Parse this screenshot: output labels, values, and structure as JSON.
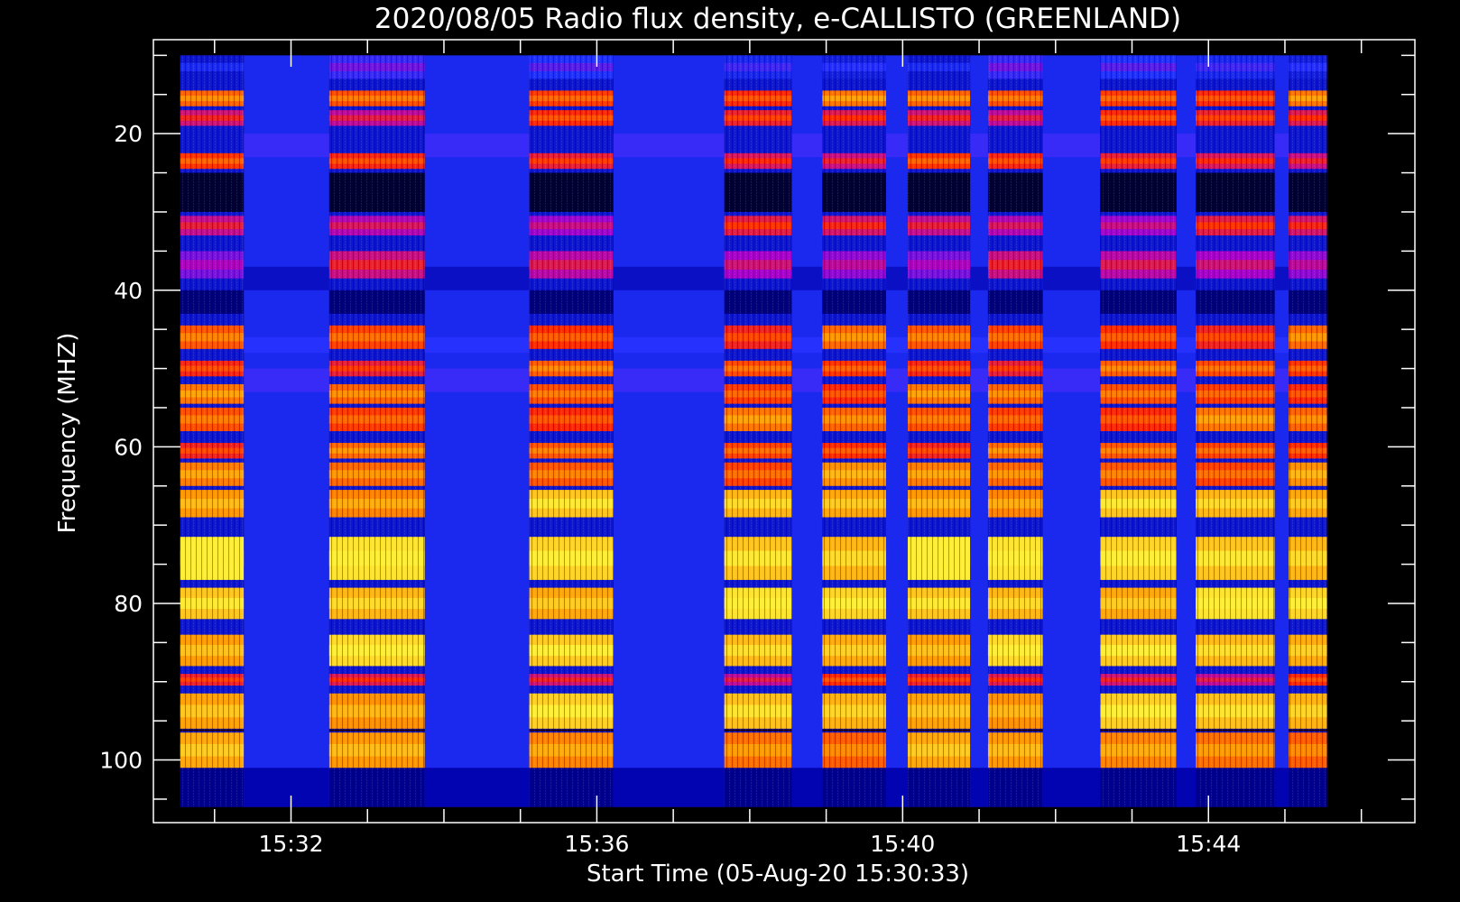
{
  "chart_data": {
    "type": "heatmap",
    "title": "2020/08/05  Radio flux density, e-CALLISTO (GREENLAND)",
    "xlabel": "Start Time (05-Aug-20 15:30:33)",
    "ylabel": "Frequency (MHZ)",
    "x_unit": "minutes",
    "x_ticks": [
      "15:32",
      "15:36",
      "15:40",
      "15:44"
    ],
    "y_ticks": [
      "20",
      "40",
      "60",
      "80",
      "100"
    ],
    "y_range": [
      8,
      108
    ],
    "y_reversed": true,
    "x_range": [
      "15:30:12",
      "15:46:42"
    ],
    "data_time_range": [
      "15:30:33",
      "15:45:33"
    ],
    "data_freq_range": [
      10,
      106
    ],
    "colormap": [
      "#000000",
      "#0000aa",
      "#2233ff",
      "#aa00cc",
      "#ff2a00",
      "#ff9900",
      "#ffee33"
    ],
    "columns": [
      {
        "start": "15:30:33",
        "end": "15:31:23",
        "state": "active"
      },
      {
        "start": "15:31:23",
        "end": "15:32:30",
        "state": "quiet"
      },
      {
        "start": "15:32:30",
        "end": "15:33:45",
        "state": "active"
      },
      {
        "start": "15:33:45",
        "end": "15:35:07",
        "state": "quiet"
      },
      {
        "start": "15:35:07",
        "end": "15:36:13",
        "state": "active"
      },
      {
        "start": "15:36:13",
        "end": "15:37:40",
        "state": "quiet"
      },
      {
        "start": "15:37:40",
        "end": "15:38:33",
        "state": "active"
      },
      {
        "start": "15:38:33",
        "end": "15:38:57",
        "state": "quiet"
      },
      {
        "start": "15:38:57",
        "end": "15:39:47",
        "state": "active"
      },
      {
        "start": "15:39:47",
        "end": "15:40:04",
        "state": "quiet"
      },
      {
        "start": "15:40:04",
        "end": "15:40:53",
        "state": "active"
      },
      {
        "start": "15:40:53",
        "end": "15:41:07",
        "state": "quiet"
      },
      {
        "start": "15:41:07",
        "end": "15:41:50",
        "state": "active"
      },
      {
        "start": "15:41:50",
        "end": "15:42:35",
        "state": "quiet"
      },
      {
        "start": "15:42:35",
        "end": "15:43:35",
        "state": "active"
      },
      {
        "start": "15:43:35",
        "end": "15:43:50",
        "state": "quiet"
      },
      {
        "start": "15:43:50",
        "end": "15:44:52",
        "state": "active"
      },
      {
        "start": "15:44:52",
        "end": "15:45:03",
        "state": "quiet"
      },
      {
        "start": "15:45:03",
        "end": "15:45:33",
        "state": "active"
      }
    ],
    "bands": [
      {
        "f0": 10,
        "f1": 13,
        "intensity": 0.3
      },
      {
        "f0": 14.5,
        "f1": 16.5,
        "intensity": 0.72
      },
      {
        "f0": 17,
        "f1": 19,
        "intensity": 0.6
      },
      {
        "f0": 22.5,
        "f1": 24.5,
        "intensity": 0.62
      },
      {
        "f0": 30.5,
        "f1": 33,
        "intensity": 0.55
      },
      {
        "f0": 35,
        "f1": 38.5,
        "intensity": 0.5
      },
      {
        "f0": 44.5,
        "f1": 47.5,
        "intensity": 0.7
      },
      {
        "f0": 49,
        "f1": 51,
        "intensity": 0.68
      },
      {
        "f0": 52,
        "f1": 54.5,
        "intensity": 0.72
      },
      {
        "f0": 55,
        "f1": 58,
        "intensity": 0.72
      },
      {
        "f0": 59.5,
        "f1": 61.5,
        "intensity": 0.7
      },
      {
        "f0": 62,
        "f1": 65,
        "intensity": 0.76
      },
      {
        "f0": 65.5,
        "f1": 69,
        "intensity": 0.86
      },
      {
        "f0": 71.5,
        "f1": 77,
        "intensity": 0.95
      },
      {
        "f0": 78,
        "f1": 82,
        "intensity": 0.92
      },
      {
        "f0": 84,
        "f1": 88,
        "intensity": 0.9
      },
      {
        "f0": 89,
        "f1": 90.5,
        "intensity": 0.6
      },
      {
        "f0": 91.5,
        "f1": 96,
        "intensity": 0.88
      },
      {
        "f0": 96.5,
        "f1": 101,
        "intensity": 0.8
      }
    ]
  }
}
